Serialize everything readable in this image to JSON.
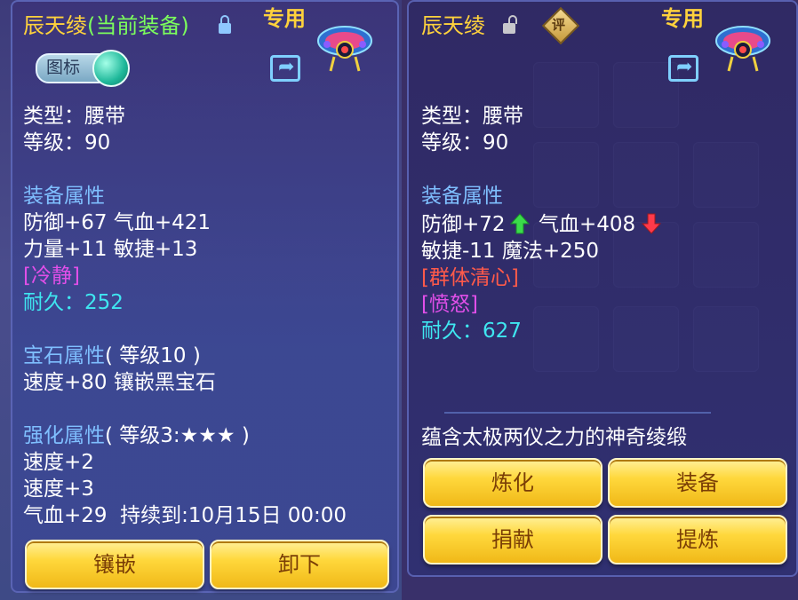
{
  "left": {
    "item_name": "辰天绫",
    "equipped_tag": "(当前装备)",
    "exclusive": "专用",
    "icon_toggle_label": "图标",
    "type": "类型：腰带",
    "level": "等级：90",
    "equip_attr_title": "装备属性",
    "attr_line1": "防御+67 气血+421",
    "attr_line2": "力量+11 敏捷+13",
    "special1": "[冷静]",
    "durability_label": "耐久：",
    "durability_value": "252",
    "gem_title": "宝石属性",
    "gem_level": "( 等级10 )",
    "gem_line": "速度+80 镶嵌黑宝石",
    "strengthen_title": "强化属性",
    "strengthen_level": "( 等级3:★★★ )",
    "strengthen_line1": "速度+2",
    "strengthen_line2": "速度+3",
    "strengthen_line3": "气血+29",
    "strengthen_expiry": "持续到:10月15日 00:00",
    "btn_inlay": "镶嵌",
    "btn_unequip": "卸下"
  },
  "right": {
    "item_name": "辰天绫",
    "rate_badge": "评",
    "exclusive": "专用",
    "type": "类型：腰带",
    "level": "等级：90",
    "equip_attr_title": "装备属性",
    "attr_line1_a": "防御+72",
    "attr_line1_b": "气血+408",
    "attr_line2": "敏捷-11 魔法+250",
    "special1": "[群体清心]",
    "special2": "[愤怒]",
    "durability_label": "耐久：",
    "durability_value": "627",
    "description": "蕴含太极两仪之力的神奇绫缎",
    "btn_refine": "炼化",
    "btn_equip": "装备",
    "btn_donate": "捐献",
    "btn_extract": "提炼"
  },
  "icons": {
    "lock_locked": "lock-icon",
    "lock_unlocked": "unlock-icon",
    "share": "share-icon",
    "arrow_up": "arrow-up-icon",
    "arrow_down": "arrow-down-icon",
    "item": "belt-item-icon"
  },
  "colors": {
    "title_gold": "#ffd23c",
    "equipped_green": "#7cff5c",
    "section_blue": "#7fbfff",
    "durability_cyan": "#3fe6f0",
    "special_magenta": "#e04fe8",
    "special_red": "#ff5a4a",
    "button_yellow": "#ffd83c",
    "button_text": "#7a3e06"
  }
}
